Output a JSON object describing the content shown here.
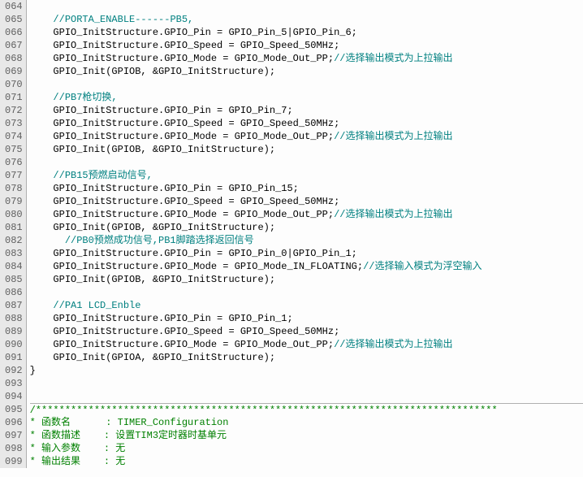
{
  "lines": [
    {
      "n": "064",
      "segs": []
    },
    {
      "n": "065",
      "segs": [
        {
          "cls": "cmt",
          "t": "    //PORTA_ENABLE------PB5,"
        }
      ]
    },
    {
      "n": "066",
      "segs": [
        {
          "cls": "plain",
          "t": "    GPIO_InitStructure.GPIO_Pin = GPIO_Pin_5|GPIO_Pin_6;"
        }
      ]
    },
    {
      "n": "067",
      "segs": [
        {
          "cls": "plain",
          "t": "    GPIO_InitStructure.GPIO_Speed = GPIO_Speed_50MHz;"
        }
      ]
    },
    {
      "n": "068",
      "segs": [
        {
          "cls": "plain",
          "t": "    GPIO_InitStructure.GPIO_Mode = GPIO_Mode_Out_PP;"
        },
        {
          "cls": "cmt",
          "t": "//选择输出模式为上拉输出"
        }
      ]
    },
    {
      "n": "069",
      "segs": [
        {
          "cls": "plain",
          "t": "    GPIO_Init(GPIOB, &GPIO_InitStructure);"
        }
      ]
    },
    {
      "n": "070",
      "segs": []
    },
    {
      "n": "071",
      "segs": [
        {
          "cls": "cmt",
          "t": "    //PB7枪切换,"
        }
      ]
    },
    {
      "n": "072",
      "segs": [
        {
          "cls": "plain",
          "t": "    GPIO_InitStructure.GPIO_Pin = GPIO_Pin_7;"
        }
      ]
    },
    {
      "n": "073",
      "segs": [
        {
          "cls": "plain",
          "t": "    GPIO_InitStructure.GPIO_Speed = GPIO_Speed_50MHz;"
        }
      ]
    },
    {
      "n": "074",
      "segs": [
        {
          "cls": "plain",
          "t": "    GPIO_InitStructure.GPIO_Mode = GPIO_Mode_Out_PP;"
        },
        {
          "cls": "cmt",
          "t": "//选择输出模式为上拉输出"
        }
      ]
    },
    {
      "n": "075",
      "segs": [
        {
          "cls": "plain",
          "t": "    GPIO_Init(GPIOB, &GPIO_InitStructure);"
        }
      ]
    },
    {
      "n": "076",
      "segs": []
    },
    {
      "n": "077",
      "segs": [
        {
          "cls": "cmt",
          "t": "    //PB15预燃启动信号,"
        }
      ]
    },
    {
      "n": "078",
      "segs": [
        {
          "cls": "plain",
          "t": "    GPIO_InitStructure.GPIO_Pin = GPIO_Pin_15;"
        }
      ]
    },
    {
      "n": "079",
      "segs": [
        {
          "cls": "plain",
          "t": "    GPIO_InitStructure.GPIO_Speed = GPIO_Speed_50MHz;"
        }
      ]
    },
    {
      "n": "080",
      "segs": [
        {
          "cls": "plain",
          "t": "    GPIO_InitStructure.GPIO_Mode = GPIO_Mode_Out_PP;"
        },
        {
          "cls": "cmt",
          "t": "//选择输出模式为上拉输出"
        }
      ]
    },
    {
      "n": "081",
      "segs": [
        {
          "cls": "plain",
          "t": "    GPIO_Init(GPIOB, &GPIO_InitStructure);"
        }
      ]
    },
    {
      "n": "082",
      "segs": [
        {
          "cls": "cmt",
          "t": "      //PB0预燃成功信号,PB1脚踏选择返回信号"
        }
      ]
    },
    {
      "n": "083",
      "segs": [
        {
          "cls": "plain",
          "t": "    GPIO_InitStructure.GPIO_Pin = GPIO_Pin_0|GPIO_Pin_1;"
        }
      ]
    },
    {
      "n": "084",
      "segs": [
        {
          "cls": "plain",
          "t": "    GPIO_InitStructure.GPIO_Mode = GPIO_Mode_IN_FLOATING;"
        },
        {
          "cls": "cmt",
          "t": "//选择输入模式为浮空输入"
        }
      ]
    },
    {
      "n": "085",
      "segs": [
        {
          "cls": "plain",
          "t": "    GPIO_Init(GPIOB, &GPIO_InitStructure);"
        }
      ]
    },
    {
      "n": "086",
      "segs": []
    },
    {
      "n": "087",
      "segs": [
        {
          "cls": "cmt",
          "t": "    //PA1 LCD_Enble"
        }
      ]
    },
    {
      "n": "088",
      "segs": [
        {
          "cls": "plain",
          "t": "    GPIO_InitStructure.GPIO_Pin = GPIO_Pin_1;"
        }
      ]
    },
    {
      "n": "089",
      "segs": [
        {
          "cls": "plain",
          "t": "    GPIO_InitStructure.GPIO_Speed = GPIO_Speed_50MHz;"
        }
      ]
    },
    {
      "n": "090",
      "segs": [
        {
          "cls": "plain",
          "t": "    GPIO_InitStructure.GPIO_Mode = GPIO_Mode_Out_PP;"
        },
        {
          "cls": "cmt",
          "t": "//选择输出模式为上拉输出"
        }
      ]
    },
    {
      "n": "091",
      "segs": [
        {
          "cls": "plain",
          "t": "    GPIO_Init(GPIOA, &GPIO_InitStructure);"
        }
      ]
    },
    {
      "n": "092",
      "segs": [
        {
          "cls": "brace",
          "t": "}"
        }
      ]
    },
    {
      "n": "093",
      "segs": []
    },
    {
      "n": "094",
      "segs": []
    },
    {
      "n": "095",
      "segs": [
        {
          "cls": "cmt2",
          "t": "/*******************************************************************************"
        }
      ],
      "hr": true
    },
    {
      "n": "096",
      "segs": [
        {
          "cls": "cmt2",
          "t": "* 函数名      : TIMER_Configuration"
        }
      ]
    },
    {
      "n": "097",
      "segs": [
        {
          "cls": "cmt2",
          "t": "* 函数描述    : 设置TIM3定时器时基单元"
        }
      ]
    },
    {
      "n": "098",
      "segs": [
        {
          "cls": "cmt2",
          "t": "* 输入参数    : 无"
        }
      ]
    },
    {
      "n": "099",
      "segs": [
        {
          "cls": "cmt2",
          "t": "* 输出结果    : 无"
        }
      ]
    }
  ]
}
